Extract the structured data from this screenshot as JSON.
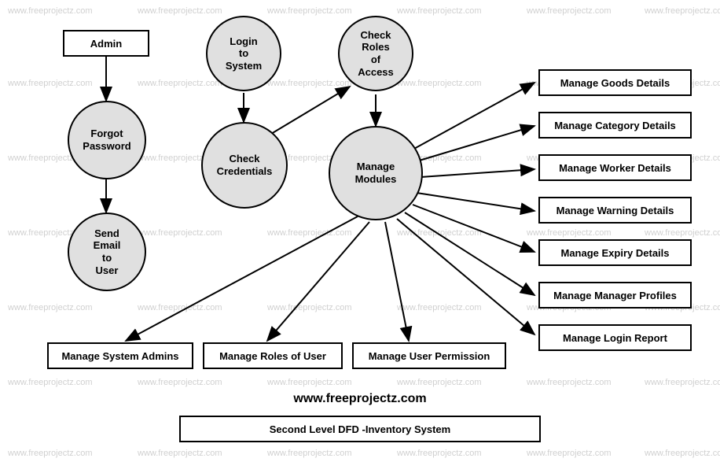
{
  "watermark_text": "www.freeprojectz.com",
  "nodes": {
    "admin": "Admin",
    "login_to_system": "Login\nto\nSystem",
    "check_roles": "Check\nRoles\nof\nAccess",
    "forgot_password": "Forgot\nPassword",
    "check_credentials": "Check\nCredentials",
    "manage_modules": "Manage\nModules",
    "send_email": "Send\nEmail\nto\nUser",
    "manage_goods": "Manage Goods Details",
    "manage_category": "Manage Category Details",
    "manage_worker": "Manage Worker Details",
    "manage_warning": "Manage Warning Details",
    "manage_expiry": "Manage Expiry Details",
    "manage_manager": "Manage Manager Profiles",
    "manage_login_report": "Manage Login Report",
    "manage_system_admins": "Manage System Admins",
    "manage_roles_user": "Manage Roles of User",
    "manage_user_permission": "Manage User Permission",
    "second_level": "Second Level DFD -Inventory System"
  },
  "url_label": "www.freeprojectz.com"
}
